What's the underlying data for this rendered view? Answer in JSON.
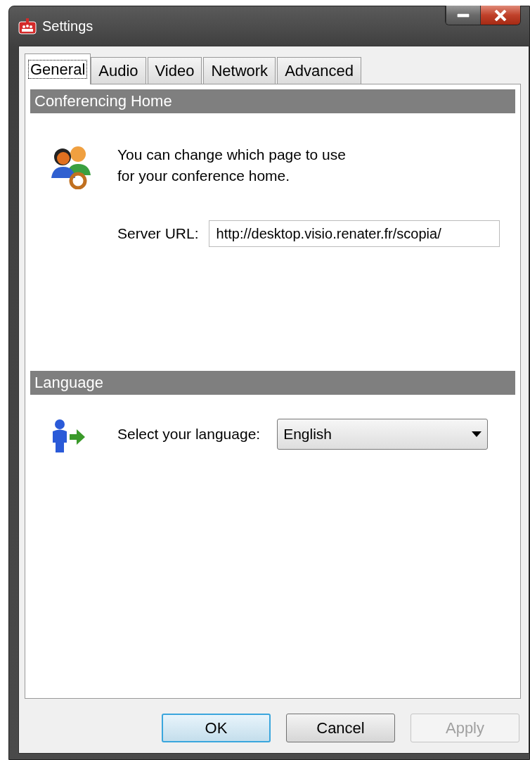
{
  "window": {
    "title": "Settings"
  },
  "tabs": [
    {
      "label": "General",
      "selected": true
    },
    {
      "label": "Audio",
      "selected": false
    },
    {
      "label": "Video",
      "selected": false
    },
    {
      "label": "Network",
      "selected": false
    },
    {
      "label": "Advanced",
      "selected": false
    }
  ],
  "sections": [
    {
      "title": "Conferencing Home",
      "kind": "url",
      "description": "You can change which page to use\nfor your conference home.",
      "field_label": "Server URL:",
      "value": "http://desktop.visio.renater.fr/scopia/"
    },
    {
      "title": "Language",
      "kind": "select",
      "field_label": "Select your language:",
      "value": "English"
    }
  ],
  "buttons": [
    {
      "label": "OK",
      "default": true,
      "disabled": false
    },
    {
      "label": "Cancel",
      "default": false,
      "disabled": false
    },
    {
      "label": "Apply",
      "default": false,
      "disabled": true
    }
  ]
}
